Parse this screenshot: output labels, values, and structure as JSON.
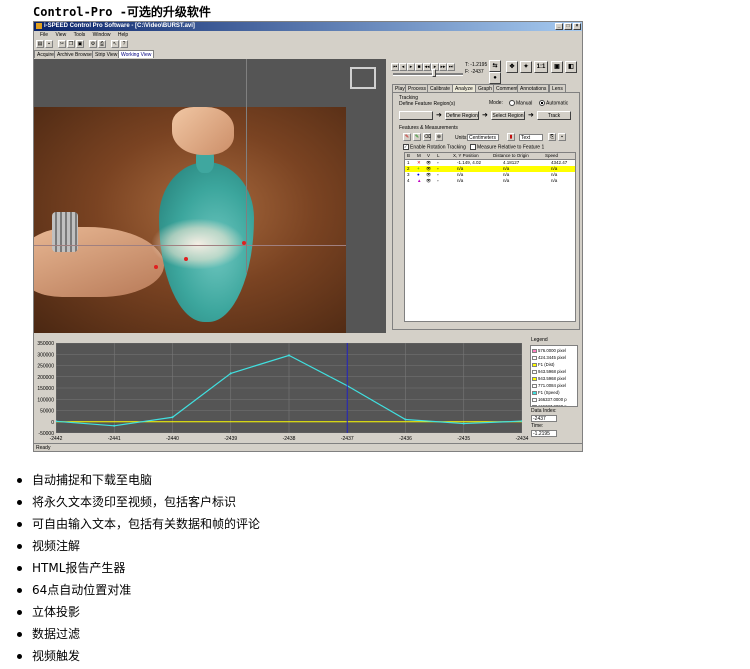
{
  "page": {
    "title": "Control-Pro -可选的升级软件",
    "features": [
      "自动捕捉和下载至电脑",
      "将永久文本烫印至视频，包括客户标识",
      "可自由输入文本，包括有关数据和帧的评论",
      "视频注解",
      "HTML报告产生器",
      "64点自动位置对准",
      "立体投影",
      "数据过滤",
      "视频触发"
    ]
  },
  "app": {
    "window_title": "i-SPEED Control Pro Software - [C:\\Video\\BURST.avi]",
    "menu": [
      "File",
      "View",
      "Tools",
      "Window",
      "Help"
    ],
    "view_tabs": [
      "Acquire",
      "Archive Browser",
      "Strip View",
      "Working View"
    ],
    "active_view_tab": "Working View",
    "status": "Ready",
    "playback": {
      "time_readout": "T: -1.2195",
      "frame_readout": "F: -2437",
      "zoom_label": "1:1"
    },
    "panel_tabs": [
      "Play",
      "Process",
      "Calibrate",
      "Analyze",
      "Graph",
      "Comment",
      "Annotations",
      "Lens"
    ],
    "active_panel_tab": "Analyze",
    "tracking": {
      "group_label": "Tracking",
      "define_feature_label": "Define Feature Region(s)",
      "mode_label": "Mode:",
      "mode_manual": "Manual",
      "mode_automatic": "Automatic",
      "mode_selected": "Automatic",
      "define_region_btn": "Define Region",
      "select_region_btn": "Select Region",
      "track_btn": "Track"
    },
    "measurements": {
      "group_label": "Features & Measurements",
      "units_label": "Units:",
      "units_value": "Centimeters",
      "text_value": "Text",
      "enable_rotation_label": "Enable Rotation Tracking",
      "enable_rotation_checked": true,
      "measure_relative_label": "Measure Relative to Feature 1",
      "measure_relative_checked": false,
      "columns": [
        "B",
        "M",
        "V",
        "L",
        "X, Y Position",
        "Distance to Origin",
        "Speed"
      ],
      "rows": [
        {
          "num": "1",
          "marker": "✕",
          "marker_color": "#e00000",
          "pos": "-1.149, 4.02",
          "dist": "4.18127",
          "speed": "4342.47"
        },
        {
          "num": "2",
          "marker": "+",
          "marker_color": "#00a000",
          "pos": "n/a",
          "dist": "n/a",
          "speed": "n/a"
        },
        {
          "num": "3",
          "marker": "●",
          "marker_color": "#0000e0",
          "pos": "n/a",
          "dist": "n/a",
          "speed": "n/a"
        },
        {
          "num": "4",
          "marker": "▲",
          "marker_color": "#c000c0",
          "pos": "n/a",
          "dist": "n/a",
          "speed": "n/a"
        }
      ],
      "selected_row": "2"
    },
    "graph": {
      "y_ticks": [
        "350000",
        "300000",
        "250000",
        "200000",
        "150000",
        "100000",
        "50000",
        "0",
        "-50000"
      ],
      "x_ticks": [
        "-2442",
        "-2441",
        "-2440",
        "-2439",
        "-2438",
        "-2437",
        "-2436",
        "-2435",
        "-2434"
      ],
      "legend_label": "Legend",
      "legend": [
        {
          "text": "576.0000 pixel",
          "color": "#ff80c0"
        },
        {
          "text": "424.3445 pixel",
          "color": "#ffffff"
        },
        {
          "text": "F1 (Dist)",
          "color": "#ffff00"
        },
        {
          "text": "943.5968 pixel",
          "color": "#ffffff"
        },
        {
          "text": "943.5968 pixel",
          "color": "#ffff00"
        },
        {
          "text": "771.0084 pixel",
          "color": "#ffffff"
        },
        {
          "text": "F1 (Speed)",
          "color": "#40e0e0"
        },
        {
          "text": "166337.0000 p",
          "color": "#ffffff"
        },
        {
          "text": "166337.0000 p",
          "color": "#40e0e0"
        }
      ],
      "data_index_label": "Data Index:",
      "data_index_value": "-2437",
      "time_label": "Time:",
      "time_value": "-1.2195",
      "speed_series": {
        "x": [
          -2442,
          -2441,
          -2440,
          -2439,
          -2438,
          -2437,
          -2436,
          -2435,
          -2434
        ],
        "y": [
          2000,
          -18000,
          20000,
          215000,
          295000,
          160000,
          10000,
          -8000,
          3000
        ],
        "color": "#40e0e0"
      },
      "dist_series": {
        "x": [
          -2442,
          -2434
        ],
        "y": [
          0,
          0
        ],
        "color": "#ffff00"
      },
      "y_range": [
        -50000,
        350000
      ],
      "x_range": [
        -2442,
        -2434
      ],
      "cursor_x": -2437
    }
  }
}
